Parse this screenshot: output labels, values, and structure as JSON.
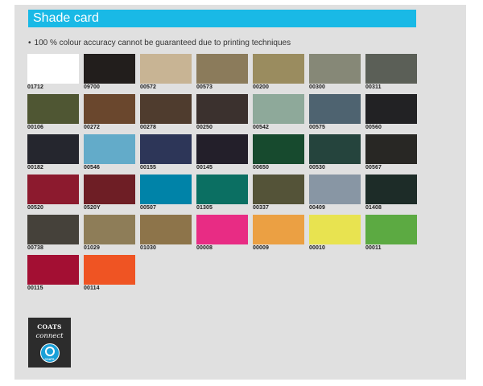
{
  "header": {
    "title": "Shade card"
  },
  "note": {
    "bullet": "•",
    "text": "100 % colour accuracy cannot be guaranteed due to printing techniques"
  },
  "swatches": [
    {
      "code": "01712",
      "color": "#ffffff"
    },
    {
      "code": "09700",
      "color": "#221e1c"
    },
    {
      "code": "00572",
      "color": "#c8b494"
    },
    {
      "code": "00573",
      "color": "#8b7b5b"
    },
    {
      "code": "00200",
      "color": "#9a8c5f"
    },
    {
      "code": "00300",
      "color": "#868877"
    },
    {
      "code": "00311",
      "color": "#5b5f57"
    },
    {
      "code": "00106",
      "color": "#4f5633"
    },
    {
      "code": "00272",
      "color": "#6a472d"
    },
    {
      "code": "00278",
      "color": "#4f3c2e"
    },
    {
      "code": "00250",
      "color": "#3b312e"
    },
    {
      "code": "00542",
      "color": "#8ea99a"
    },
    {
      "code": "00575",
      "color": "#4e6370"
    },
    {
      "code": "00560",
      "color": "#222224"
    },
    {
      "code": "00182",
      "color": "#25262e"
    },
    {
      "code": "00546",
      "color": "#63abc9"
    },
    {
      "code": "00155",
      "color": "#2d3658"
    },
    {
      "code": "00145",
      "color": "#231f2a"
    },
    {
      "code": "00650",
      "color": "#174a2e"
    },
    {
      "code": "00530",
      "color": "#25443d"
    },
    {
      "code": "00567",
      "color": "#282724"
    },
    {
      "code": "00520",
      "color": "#8c1a2e"
    },
    {
      "code": "0520Y",
      "color": "#6e1e25"
    },
    {
      "code": "00507",
      "color": "#0083a8"
    },
    {
      "code": "01305",
      "color": "#0b6f62"
    },
    {
      "code": "00337",
      "color": "#545338"
    },
    {
      "code": "00409",
      "color": "#8896a4"
    },
    {
      "code": "01408",
      "color": "#1d2c28"
    },
    {
      "code": "00738",
      "color": "#45413a"
    },
    {
      "code": "01029",
      "color": "#8e7d58"
    },
    {
      "code": "01030",
      "color": "#8d744a"
    },
    {
      "code": "00008",
      "color": "#e82c84"
    },
    {
      "code": "00009",
      "color": "#eba043"
    },
    {
      "code": "00010",
      "color": "#e8e350"
    },
    {
      "code": "00011",
      "color": "#5caa42"
    },
    {
      "code": "00115",
      "color": "#a30f33"
    },
    {
      "code": "00114",
      "color": "#ef5423"
    }
  ],
  "logo": {
    "brand": "COATS",
    "sub": "connect",
    "badge": "COATS"
  }
}
